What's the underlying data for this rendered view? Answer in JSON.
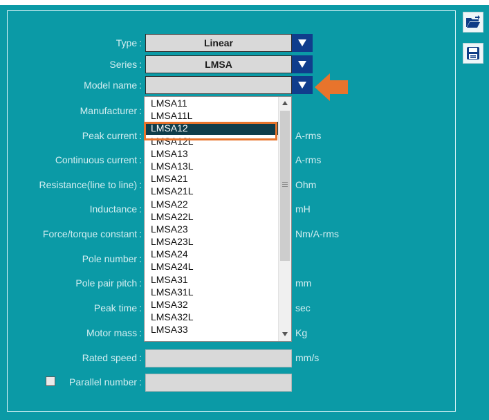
{
  "form": {
    "type": {
      "label": "Type",
      "value": "Linear"
    },
    "series": {
      "label": "Series",
      "value": "LMSA"
    },
    "model_name": {
      "label": "Model name",
      "value": ""
    },
    "manufacturer": {
      "label": "Manufacturer"
    },
    "peak_current": {
      "label": "Peak current",
      "unit": "A-rms"
    },
    "continuous_current": {
      "label": "Continuous current",
      "unit": "A-rms"
    },
    "resistance": {
      "label": "Resistance(line to line)",
      "unit": "Ohm"
    },
    "inductance": {
      "label": "Inductance",
      "unit": "mH"
    },
    "force_constant": {
      "label": "Force/torque constant",
      "unit": "Nm/A-rms"
    },
    "pole_number": {
      "label": "Pole number"
    },
    "pole_pair_pitch": {
      "label": "Pole pair pitch",
      "unit": "mm"
    },
    "peak_time": {
      "label": "Peak time",
      "unit": "sec"
    },
    "motor_mass": {
      "label": "Motor mass",
      "unit": "Kg"
    },
    "rated_speed": {
      "label": "Rated speed",
      "unit": "mm/s"
    },
    "parallel_number": {
      "label": "Parallel number",
      "checked": false
    },
    "colon": ":"
  },
  "dropdown": {
    "selected": "LMSA12",
    "items": [
      "LMSA11",
      "LMSA11L",
      "LMSA12",
      "LMSA12L",
      "LMSA13",
      "LMSA13L",
      "LMSA21",
      "LMSA21L",
      "LMSA22",
      "LMSA22L",
      "LMSA23",
      "LMSA23L",
      "LMSA24",
      "LMSA24L",
      "LMSA31",
      "LMSA31L",
      "LMSA32",
      "LMSA32L",
      "LMSA33"
    ]
  },
  "icons": {
    "open": "open-folder-icon",
    "save": "save-disk-icon"
  },
  "colors": {
    "background": "#0b9aa6",
    "arrow_button": "#103d8c",
    "highlight_border": "#e8742c",
    "selected_item": "#103d4a"
  }
}
